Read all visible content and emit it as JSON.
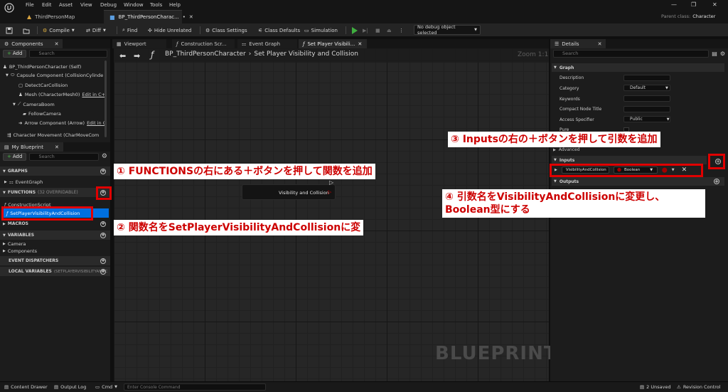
{
  "window": {
    "menu": [
      "File",
      "Edit",
      "Asset",
      "View",
      "Debug",
      "Window",
      "Tools",
      "Help"
    ],
    "tabs": [
      "ThirdPersonMap",
      "BP_ThirdPersonCharac..."
    ],
    "parent_class_label": "Parent class:",
    "parent_class_value": "Character"
  },
  "toolbar": {
    "compile": "Compile",
    "diff": "Diff",
    "find": "Find",
    "hide_unrelated": "Hide Unrelated",
    "class_settings": "Class Settings",
    "class_defaults": "Class Defaults",
    "simulation": "Simulation",
    "debug_object": "No debug object selected"
  },
  "components": {
    "tab": "Components",
    "add": "Add",
    "search_placeholder": "Search",
    "items": [
      {
        "label": "BP_ThirdPersonCharacter (Self)"
      },
      {
        "label": "Capsule Component (CollisionCylinde"
      },
      {
        "label": "DetectCarCollision"
      },
      {
        "label": "Mesh (CharacterMesh0)",
        "link": "Edit in C+"
      },
      {
        "label": "CameraBoom"
      },
      {
        "label": "FollowCamera"
      },
      {
        "label": "Arrow Component (Arrow)",
        "link": "Edit in C"
      },
      {
        "label": "Character Movement (CharMoveCom"
      }
    ]
  },
  "my_blueprint": {
    "tab": "My Blueprint",
    "add": "Add",
    "search_placeholder": "Search",
    "graphs": "GRAPHS",
    "event_graph": "EventGraph",
    "functions": "FUNCTIONS",
    "functions_count": "(32 OVERRIDABLE)",
    "construction_script": "ConstructionScript",
    "selected_function": "SetPlayerVisibilityAndCollision",
    "macros": "MACROS",
    "variables": "VARIABLES",
    "camera": "Camera",
    "components": "Components",
    "event_dispatchers": "EVENT DISPATCHERS",
    "local_variables": "LOCAL VARIABLES",
    "local_variables_scope": "(SETPLAYERVISIBILITYANDC"
  },
  "editor_tabs": [
    "Viewport",
    "Construction Scr...",
    "Event Graph",
    "Set Player Visibili..."
  ],
  "graph": {
    "breadcrumb_root": "BP_ThirdPersonCharacter",
    "breadcrumb_sep": "›",
    "breadcrumb_leaf": "Set Player Visibility and Collision",
    "zoom": "Zoom 1:1",
    "node_label": "Visibility and Collision",
    "watermark": "BLUEPRINT"
  },
  "details": {
    "tab": "Details",
    "search_placeholder": "Search",
    "graph_section": "Graph",
    "description": "Description",
    "category": "Category",
    "category_value": "Default",
    "keywords": "Keywords",
    "compact_node_title": "Compact Node Title",
    "access_specifier": "Access Specifier",
    "access_value": "Public",
    "pure": "Pure",
    "advanced": "Advanced",
    "inputs_section": "Inputs",
    "input_name": "VisibilityAndCollision",
    "input_type": "Boolean",
    "outputs_section": "Outputs"
  },
  "annotations": {
    "step1": "① FUNCTIONSの右にある＋ボタンを押して関数を追加",
    "step2": "② 関数名をSetPlayerVisibilityAndCollisionに変",
    "step3": "③ Inputsの右の＋ボタンを押して引数を追加",
    "step4_line1": "④ 引数名をVisibilityAndCollisionに変更し、",
    "step4_line2": "Boolean型にする"
  },
  "statusbar": {
    "content_drawer": "Content Drawer",
    "output_log": "Output Log",
    "cmd": "Cmd",
    "console_placeholder": "Enter Console Command",
    "unsaved": "2 Unsaved",
    "revision_control": "Revision Control"
  },
  "colors": {
    "selection_blue": "#0070e0",
    "annotation_red": "#e00000",
    "boolean_pin": "#8c0000",
    "play_green": "#3fae3f"
  }
}
